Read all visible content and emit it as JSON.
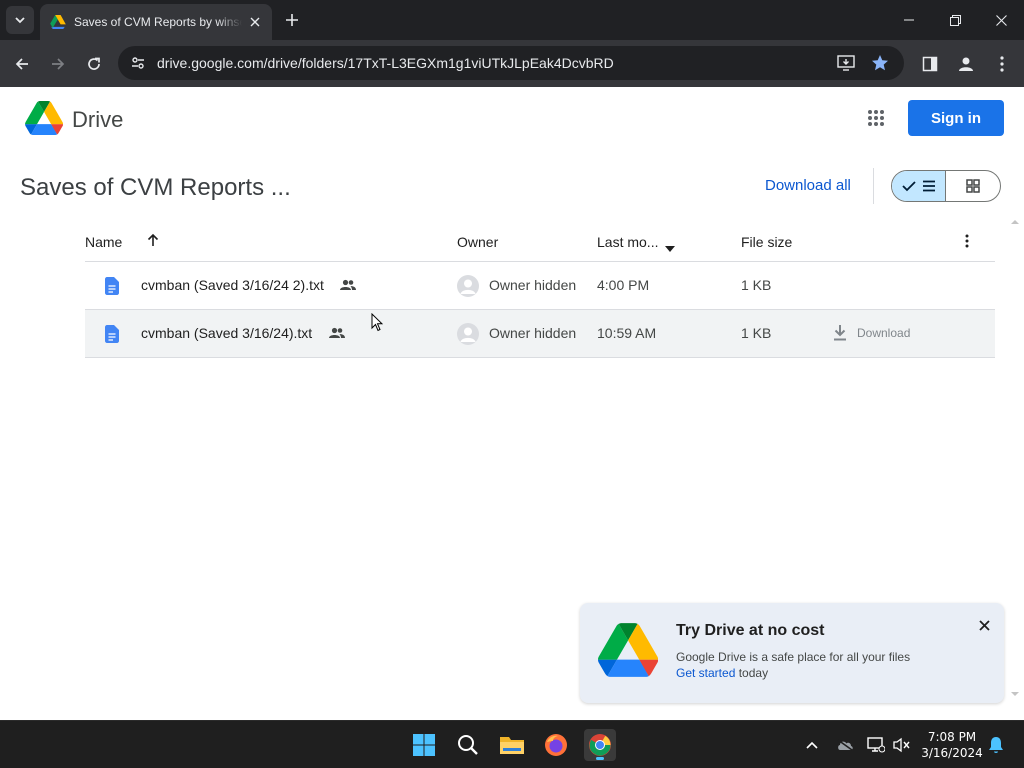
{
  "browser": {
    "tab_title": "Saves of CVM Reports by winse",
    "url": "drive.google.com/drive/folders/17TxT-L3EGXm1g1viUTkJLpEak4DcvbRD"
  },
  "drive": {
    "brand": "Drive",
    "sign_in_label": "Sign in",
    "folder_title": "Saves of CVM Reports ...",
    "download_all_label": "Download all",
    "columns": {
      "name": "Name",
      "owner": "Owner",
      "modified": "Last mo...",
      "size": "File size"
    },
    "files": [
      {
        "name": "cvmban (Saved 3/16/24 2).txt",
        "owner": "Owner hidden",
        "modified": "4:00 PM",
        "size": "1 KB"
      },
      {
        "name": "cvmban (Saved 3/16/24).txt",
        "owner": "Owner hidden",
        "modified": "10:59 AM",
        "size": "1 KB",
        "action_label": "Download"
      }
    ]
  },
  "promo": {
    "title": "Try Drive at no cost",
    "body": "Google Drive is a safe place for all your files",
    "link": "Get started",
    "link_suffix": " today"
  },
  "taskbar": {
    "time": "7:08 PM",
    "date": "3/16/2024"
  },
  "colors": {
    "accent": "#1a73e8",
    "link": "#0b57d0",
    "list_toggle_active": "#c2e7ff",
    "doc_icon": "#4285f4"
  }
}
